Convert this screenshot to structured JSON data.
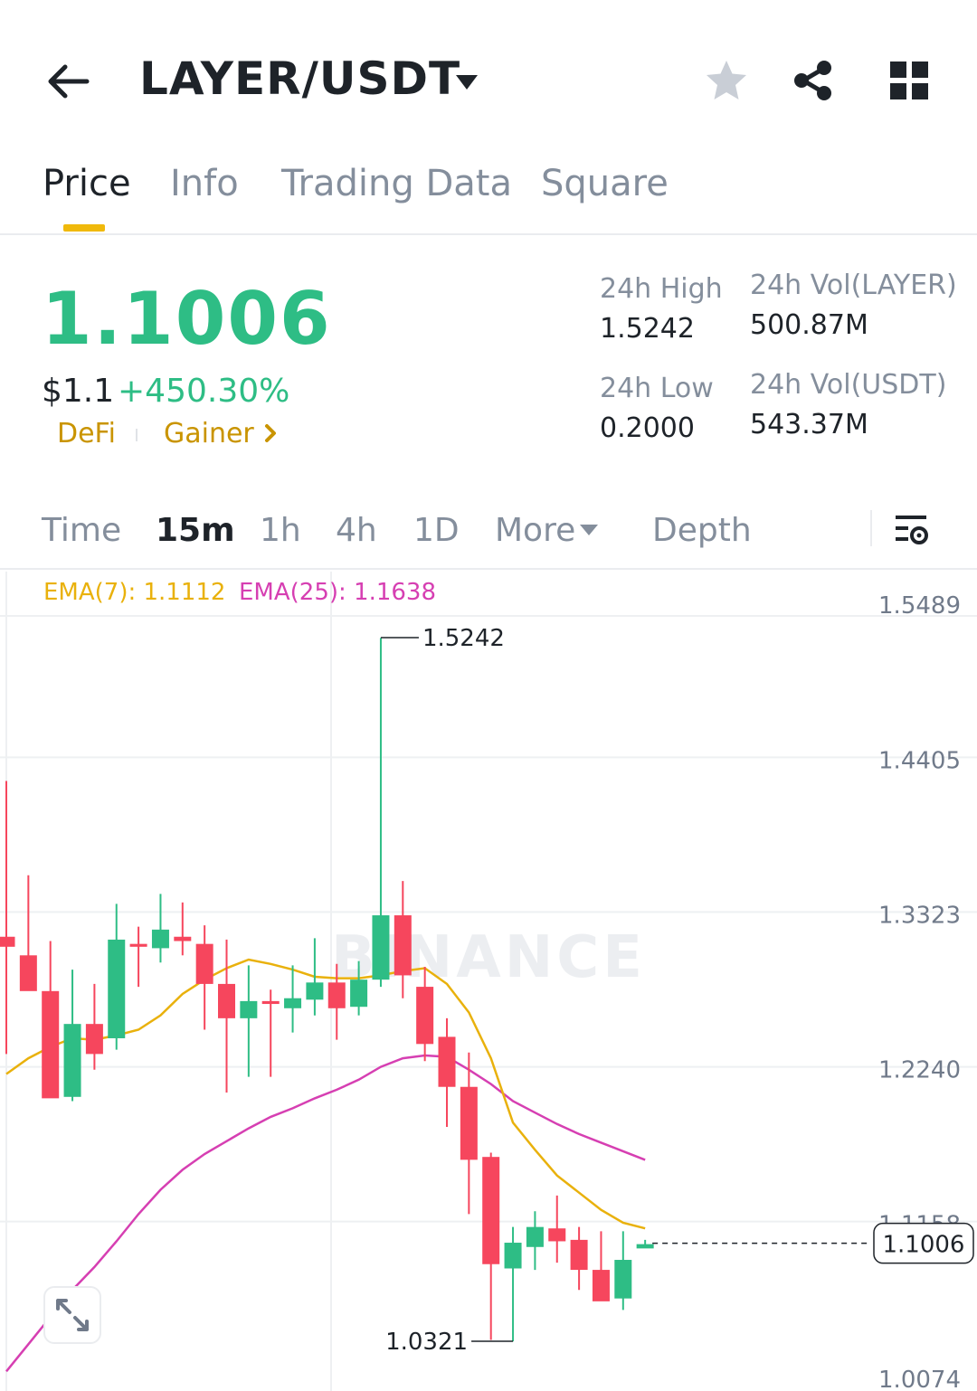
{
  "header": {
    "pair": "LAYER/USDT"
  },
  "tabs": [
    {
      "label": "Price",
      "active": true
    },
    {
      "label": "Info",
      "active": false
    },
    {
      "label": "Trading Data",
      "active": false
    },
    {
      "label": "Square",
      "active": false
    }
  ],
  "price": {
    "last": "1.1006",
    "usd": "$1.1",
    "change_pct": "+450.30%",
    "tags": [
      "DeFi",
      "Gainer"
    ]
  },
  "stats": {
    "high_label": "24h High",
    "high_value": "1.5242",
    "low_label": "24h Low",
    "low_value": "0.2000",
    "vol_base_label": "24h Vol(LAYER)",
    "vol_base_value": "500.87M",
    "vol_quote_label": "24h Vol(USDT)",
    "vol_quote_value": "543.37M"
  },
  "intervals": [
    {
      "label": "Time",
      "active": false
    },
    {
      "label": "15m",
      "active": true
    },
    {
      "label": "1h",
      "active": false
    },
    {
      "label": "4h",
      "active": false
    },
    {
      "label": "1D",
      "active": false
    },
    {
      "label": "More",
      "active": false
    },
    {
      "label": "Depth",
      "active": false
    }
  ],
  "indicators": {
    "ema7": "EMA(7): 1.1112",
    "ema25": "EMA(25): 1.1638"
  },
  "colors": {
    "up": "#2ebd85",
    "down": "#f6465d",
    "ema7": "#e9b10c",
    "ema25": "#d63fb2",
    "accent": "#f0b90b"
  },
  "chart_data": {
    "type": "candlestick",
    "interval": "15m",
    "y_ticks": [
      "1.5489",
      "1.4405",
      "1.3323",
      "1.2240",
      "1.1158",
      "1.0074"
    ],
    "ylim": [
      1.0074,
      1.5489
    ],
    "last_price_label": "1.1006",
    "high_marker": "1.5242",
    "low_marker": "1.0321",
    "watermark": "BINANCE",
    "candles": [
      {
        "o": 1.315,
        "h": 1.424,
        "l": 1.233,
        "c": 1.308
      },
      {
        "o": 1.302,
        "h": 1.358,
        "l": 1.283,
        "c": 1.277
      },
      {
        "o": 1.277,
        "h": 1.312,
        "l": 1.21,
        "c": 1.202
      },
      {
        "o": 1.203,
        "h": 1.292,
        "l": 1.2,
        "c": 1.254
      },
      {
        "o": 1.254,
        "h": 1.282,
        "l": 1.222,
        "c": 1.233
      },
      {
        "o": 1.244,
        "h": 1.338,
        "l": 1.236,
        "c": 1.313
      },
      {
        "o": 1.31,
        "h": 1.322,
        "l": 1.28,
        "c": 1.308
      },
      {
        "o": 1.307,
        "h": 1.345,
        "l": 1.297,
        "c": 1.32
      },
      {
        "o": 1.315,
        "h": 1.339,
        "l": 1.302,
        "c": 1.312
      },
      {
        "o": 1.31,
        "h": 1.323,
        "l": 1.25,
        "c": 1.282
      },
      {
        "o": 1.282,
        "h": 1.313,
        "l": 1.206,
        "c": 1.258
      },
      {
        "o": 1.258,
        "h": 1.295,
        "l": 1.217,
        "c": 1.27
      },
      {
        "o": 1.27,
        "h": 1.278,
        "l": 1.217,
        "c": 1.268
      },
      {
        "o": 1.265,
        "h": 1.295,
        "l": 1.248,
        "c": 1.272
      },
      {
        "o": 1.271,
        "h": 1.314,
        "l": 1.26,
        "c": 1.283
      },
      {
        "o": 1.283,
        "h": 1.296,
        "l": 1.243,
        "c": 1.265
      },
      {
        "o": 1.266,
        "h": 1.298,
        "l": 1.26,
        "c": 1.285
      },
      {
        "o": 1.285,
        "h": 1.524,
        "l": 1.28,
        "c": 1.33
      },
      {
        "o": 1.33,
        "h": 1.354,
        "l": 1.272,
        "c": 1.288
      },
      {
        "o": 1.28,
        "h": 1.294,
        "l": 1.228,
        "c": 1.24
      },
      {
        "o": 1.245,
        "h": 1.258,
        "l": 1.182,
        "c": 1.21
      },
      {
        "o": 1.21,
        "h": 1.234,
        "l": 1.121,
        "c": 1.159
      },
      {
        "o": 1.161,
        "h": 1.164,
        "l": 1.033,
        "c": 1.086
      },
      {
        "o": 1.083,
        "h": 1.112,
        "l": 1.032,
        "c": 1.101
      },
      {
        "o": 1.098,
        "h": 1.123,
        "l": 1.082,
        "c": 1.112
      },
      {
        "o": 1.111,
        "h": 1.134,
        "l": 1.087,
        "c": 1.102
      },
      {
        "o": 1.103,
        "h": 1.112,
        "l": 1.068,
        "c": 1.082
      },
      {
        "o": 1.082,
        "h": 1.109,
        "l": 1.061,
        "c": 1.06
      },
      {
        "o": 1.062,
        "h": 1.109,
        "l": 1.054,
        "c": 1.089
      },
      {
        "o": 1.097,
        "h": 1.103,
        "l": 1.099,
        "c": 1.1
      }
    ],
    "ema7_line": [
      1.219,
      1.23,
      1.238,
      1.244,
      1.243,
      1.246,
      1.25,
      1.26,
      1.275,
      1.285,
      1.293,
      1.299,
      1.296,
      1.292,
      1.287,
      1.286,
      1.286,
      1.288,
      1.291,
      1.293,
      1.282,
      1.262,
      1.23,
      1.185,
      1.166,
      1.148,
      1.136,
      1.124,
      1.115,
      1.111
    ],
    "ema25_line": [
      1.011,
      1.03,
      1.049,
      1.068,
      1.084,
      1.102,
      1.121,
      1.138,
      1.152,
      1.163,
      1.172,
      1.181,
      1.189,
      1.195,
      1.202,
      1.208,
      1.215,
      1.224,
      1.23,
      1.232,
      1.231,
      1.222,
      1.212,
      1.2,
      1.192,
      1.184,
      1.177,
      1.171,
      1.165,
      1.159
    ]
  }
}
